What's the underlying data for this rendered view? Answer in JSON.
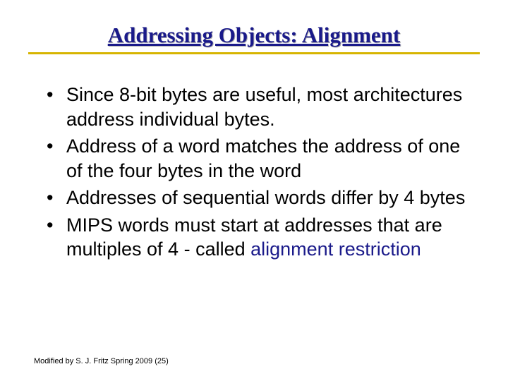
{
  "title": "Addressing Objects: Alignment",
  "bullets": {
    "b1": "Since 8-bit bytes are useful, most architectures address individual bytes.",
    "b2": "Address of a word matches the address of one of the four bytes in the word",
    "b3": "Addresses of sequential words differ by 4 bytes",
    "b4_a": "MIPS words must start at addresses that are multiples of 4 - called ",
    "b4_kw": "alignment restriction"
  },
  "footer": "Modified by S. J. Fritz  Spring 2009 (25)"
}
